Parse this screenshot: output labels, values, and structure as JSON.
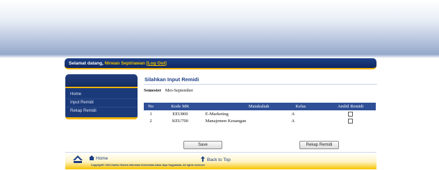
{
  "welcome": {
    "greeting": "Selamat datang,",
    "user_name": "Nirwan Septriawan",
    "logout_label": "Log Out"
  },
  "sidebar": {
    "items": [
      {
        "label": "Home"
      },
      {
        "label": "Input Remidi"
      },
      {
        "label": "Rekap Remidi"
      }
    ]
  },
  "main": {
    "title": "Silahkan Input Remidi",
    "semester_label": "Semester",
    "semester_value": "Mei-September",
    "table": {
      "headers": [
        "No",
        "Kode MK",
        "Matakuliah",
        "Kelas",
        "Ambil Remidi"
      ],
      "rows": [
        {
          "no": "1",
          "kode": "EEU800",
          "matakuliah": "E-Marketing",
          "kelas": "A",
          "ambil": false
        },
        {
          "no": "2",
          "kode": "KEU700",
          "matakuliah": "Manajemen Keuangan",
          "kelas": "A",
          "ambil": false
        }
      ]
    },
    "buttons": {
      "save": "Save",
      "rekap": "Rekap Remidi"
    }
  },
  "footer": {
    "home_label": "Home",
    "back_to_top_label": "Back to Top",
    "copyright": "Copyright© 2011 Kantor Sistem Informasi Universitas Atma Jaya Yogyakarta. All rights reserved"
  },
  "colors": {
    "primary_blue": "#1d3f86",
    "accent_yellow": "#f2b400",
    "table_header": "#2f4f96"
  }
}
